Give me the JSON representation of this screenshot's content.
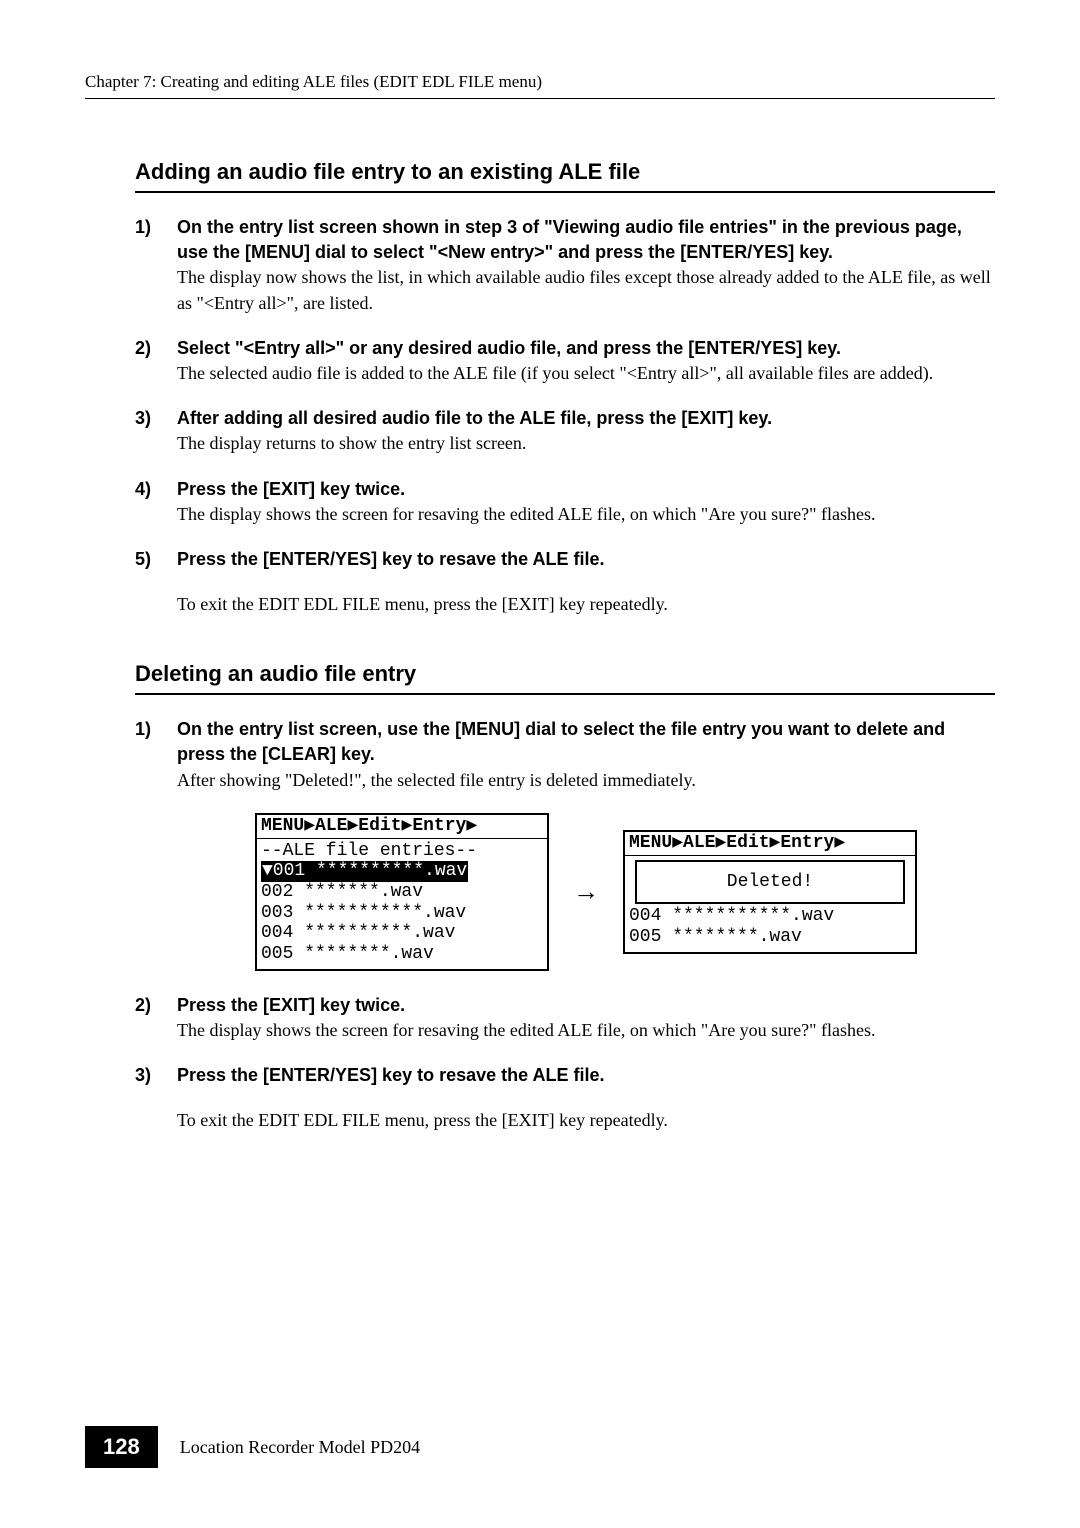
{
  "running_head": "Chapter 7: Creating and editing ALE files (EDIT EDL FILE menu)",
  "section1": {
    "heading": "Adding an audio file entry to an existing ALE file",
    "steps": [
      {
        "num": "1)",
        "lead": "On the entry list screen shown in step 3 of \"Viewing audio file entries\" in the previous page, use the [MENU] dial to select \"<New entry>\" and press the [ENTER/YES] key.",
        "desc": "The display now shows the list, in which available audio files except those already added to the ALE file, as well as \"<Entry all>\", are listed."
      },
      {
        "num": "2)",
        "lead": "Select \"<Entry all>\" or any desired audio file, and press the [ENTER/YES] key.",
        "desc": "The selected audio file is added to the ALE file (if you select \"<Entry all>\", all available files are added)."
      },
      {
        "num": "3)",
        "lead": "After adding all desired audio file to the ALE file, press the [EXIT] key.",
        "desc": "The display returns to show the entry list screen."
      },
      {
        "num": "4)",
        "lead": "Press the [EXIT] key twice.",
        "desc": "The display shows the screen for resaving the edited ALE file, on which \"Are you sure?\" flashes."
      },
      {
        "num": "5)",
        "lead": "Press the [ENTER/YES] key to resave the ALE file.",
        "desc": ""
      }
    ],
    "after": "To exit the EDIT EDL FILE menu, press the [EXIT] key repeatedly."
  },
  "section2": {
    "heading": "Deleting an audio file entry",
    "steps_a": [
      {
        "num": "1)",
        "lead": "On the entry list screen, use the [MENU] dial to select the file entry you want to delete and press the [CLEAR] key.",
        "desc": "After showing \"Deleted!\", the selected file entry is deleted immediately."
      }
    ],
    "lcd_left": {
      "title": "MENU▶ALE▶Edit▶Entry▶",
      "header": "--ALE file entries--",
      "sel": "▼001 **********.wav",
      "l2": " 002 *******.wav",
      "l3": " 003 ***********.wav",
      "l4": " 004 **********.wav",
      "l5": " 005 ********.wav"
    },
    "arrow": "→",
    "lcd_right": {
      "title": "MENU▶ALE▶Edit▶Entry▶",
      "popup": "Deleted!",
      "l4": " 004 ***********.wav",
      "l5": " 005 ********.wav"
    },
    "steps_b": [
      {
        "num": "2)",
        "lead": "Press the [EXIT] key twice.",
        "desc": "The display shows the screen for resaving the edited ALE file, on which \"Are you sure?\" flashes."
      },
      {
        "num": "3)",
        "lead": "Press the [ENTER/YES] key to resave the ALE file.",
        "desc": ""
      }
    ],
    "after": "To exit the EDIT EDL FILE menu, press the [EXIT] key repeatedly."
  },
  "footer": {
    "page": "128",
    "model": "Location Recorder  Model PD204"
  }
}
